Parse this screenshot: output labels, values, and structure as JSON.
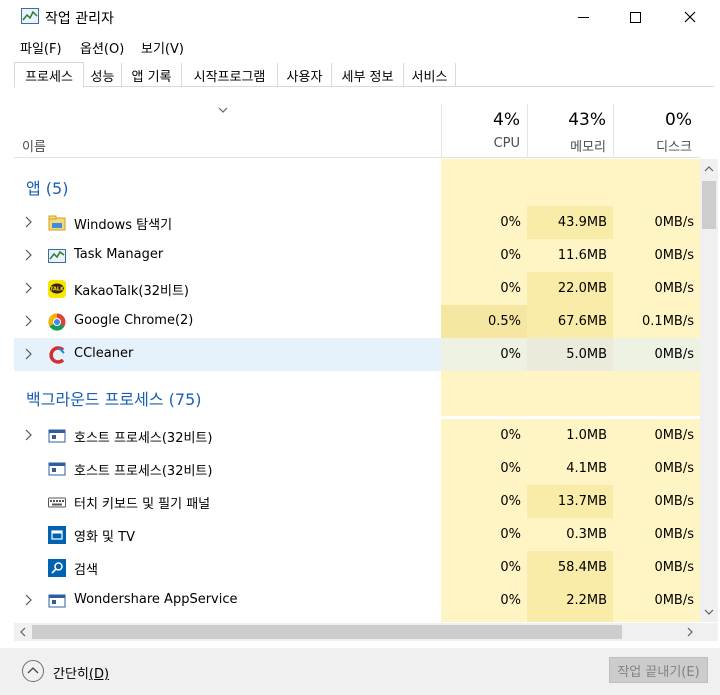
{
  "window": {
    "title": "작업 관리자"
  },
  "menu": [
    {
      "label": "파일",
      "key": "(F)"
    },
    {
      "label": "옵션",
      "key": "(O)"
    },
    {
      "label": "보기",
      "key": "(V)"
    }
  ],
  "tabs": [
    "프로세스",
    "성능",
    "앱 기록",
    "시작프로그램",
    "사용자",
    "세부 정보",
    "서비스"
  ],
  "header": {
    "name": "이름",
    "cpu": {
      "pct": "4%",
      "label": "CPU"
    },
    "mem": {
      "pct": "43%",
      "label": "메모리"
    },
    "disk": {
      "pct": "0%",
      "label": "디스크"
    }
  },
  "groups": {
    "apps": "앱 (5)",
    "background": "백그라운드 프로세스 (75)"
  },
  "apps": [
    {
      "name": "Windows 탐색기",
      "cpu": "0%",
      "mem": "43.9MB",
      "disk": "0MB/s",
      "icon": "folder-icon"
    },
    {
      "name": "Task Manager",
      "cpu": "0%",
      "mem": "11.6MB",
      "disk": "0MB/s",
      "icon": "task-manager-icon"
    },
    {
      "name": "KakaoTalk(32비트)",
      "cpu": "0%",
      "mem": "22.0MB",
      "disk": "0MB/s",
      "icon": "kakaotalk-icon",
      "icon_text": "TALK"
    },
    {
      "name": "Google Chrome(2)",
      "cpu": "0.5%",
      "mem": "67.6MB",
      "disk": "0.1MB/s",
      "icon": "chrome-icon"
    },
    {
      "name": "CCleaner",
      "cpu": "0%",
      "mem": "5.0MB",
      "disk": "0MB/s",
      "icon": "ccleaner-icon"
    }
  ],
  "background": [
    {
      "name": "호스트 프로세스(32비트)",
      "cpu": "0%",
      "mem": "1.0MB",
      "disk": "0MB/s",
      "icon": "host-process-icon"
    },
    {
      "name": "호스트 프로세스(32비트)",
      "cpu": "0%",
      "mem": "4.1MB",
      "disk": "0MB/s",
      "icon": "host-process-icon"
    },
    {
      "name": "터치 키보드 및 필기 패널",
      "cpu": "0%",
      "mem": "13.7MB",
      "disk": "0MB/s",
      "icon": "keyboard-icon"
    },
    {
      "name": "영화 및 TV",
      "cpu": "0%",
      "mem": "0.3MB",
      "disk": "0MB/s",
      "icon": "movies-tv-icon"
    },
    {
      "name": "검색",
      "cpu": "0%",
      "mem": "58.4MB",
      "disk": "0MB/s",
      "icon": "search-icon"
    },
    {
      "name": "Wondershare AppService",
      "cpu": "0%",
      "mem": "2.2MB",
      "disk": "0MB/s",
      "icon": "host-process-icon"
    }
  ],
  "footer": {
    "fewer_label": "간단히",
    "fewer_key": "(D)",
    "end_task_label": "작업 끝내기",
    "end_task_key": "(E)"
  },
  "colors": {
    "heat_light": "#fff4c4",
    "heat_mid": "#f9eca8",
    "heat_cpu_active": "#f5e6a1",
    "selected": "#e5f1fb",
    "group_title": "#1a5fb4"
  }
}
